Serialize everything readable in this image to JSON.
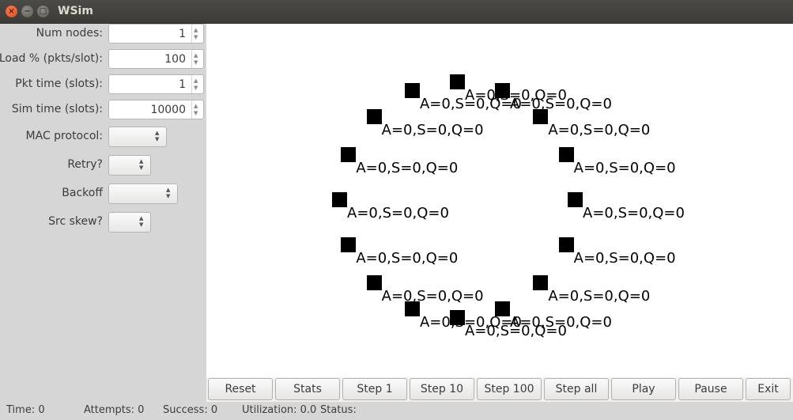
{
  "window": {
    "title": "WSim"
  },
  "sidebar": {
    "num_nodes": {
      "label": "Num nodes:",
      "value": "1"
    },
    "load": {
      "label": "Load % (pkts/slot):",
      "value": "100"
    },
    "pkt_time": {
      "label": "Pkt time (slots):",
      "value": "1"
    },
    "sim_time": {
      "label": "Sim time (slots):",
      "value": "10000"
    },
    "mac_protocol": {
      "label": "MAC protocol:",
      "value": ""
    },
    "retry": {
      "label": "Retry?",
      "value": ""
    },
    "backoff": {
      "label": "Backoff",
      "value": ""
    },
    "src_skew": {
      "label": "Src skew?",
      "value": ""
    }
  },
  "nodes": {
    "label": "A=0,S=0,Q=0",
    "count": 16
  },
  "buttons": {
    "reset": "Reset",
    "stats": "Stats",
    "step1": "Step 1",
    "step10": "Step 10",
    "step100": "Step 100",
    "stepall": "Step all",
    "play": "Play",
    "pause": "Pause",
    "exit": "Exit"
  },
  "status": {
    "time": "Time: 0",
    "attempts": "Attempts: 0",
    "success": "Success: 0",
    "utilization": "Utilization: 0.0",
    "status": "Status:"
  }
}
